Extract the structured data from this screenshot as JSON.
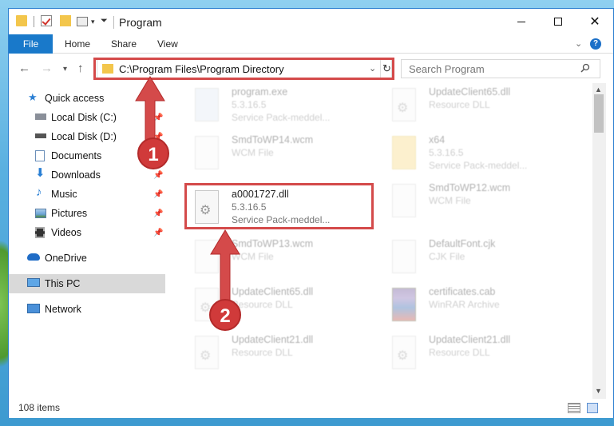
{
  "window": {
    "title": "Program",
    "controls": {
      "minimize": "minimize",
      "maximize": "maximize",
      "close": "✕"
    }
  },
  "ribbon": {
    "tabs": [
      "File",
      "Home",
      "Share",
      "View"
    ],
    "help": "?"
  },
  "nav": {
    "address": "C:\\Program Files\\Program Directory",
    "search_placeholder": "Search Program"
  },
  "sidebar": {
    "items": [
      {
        "label": "Quick access",
        "icon": "star-icon",
        "pinned": false
      },
      {
        "label": "Local Disk (C:)",
        "icon": "drive-icon",
        "pinned": true
      },
      {
        "label": "Local Disk (D:)",
        "icon": "drive-icon",
        "pinned": true
      },
      {
        "label": "Documents",
        "icon": "documents-icon",
        "pinned": true
      },
      {
        "label": "Downloads",
        "icon": "download-icon",
        "pinned": true
      },
      {
        "label": "Music",
        "icon": "music-icon",
        "pinned": true
      },
      {
        "label": "Pictures",
        "icon": "pictures-icon",
        "pinned": true
      },
      {
        "label": "Videos",
        "icon": "videos-icon",
        "pinned": true
      },
      {
        "label": "OneDrive",
        "icon": "cloud-icon",
        "pinned": false
      },
      {
        "label": "This PC",
        "icon": "pc-icon",
        "pinned": false,
        "selected": true
      },
      {
        "label": "Network",
        "icon": "network-icon",
        "pinned": false
      }
    ]
  },
  "files": [
    {
      "name": "program.exe",
      "type": "5.3.16.5",
      "size": "Service Pack-meddel...",
      "icon": "exe"
    },
    {
      "name": "UpdateClient65.dll",
      "type": "Resource DLL",
      "size": "",
      "icon": "dll"
    },
    {
      "name": "SmdToWP14.wcm",
      "type": "WCM File",
      "size": "",
      "icon": "doc"
    },
    {
      "name": "x64",
      "type": "5.3.16.5",
      "size": "Service Pack-meddel...",
      "icon": "folder"
    },
    {
      "name": "a0001727.dll",
      "type": "5.3.16.5",
      "size": "Service Pack-meddel...",
      "icon": "dll",
      "highlighted": true
    },
    {
      "name": "SmdToWP12.wcm",
      "type": "WCM File",
      "size": "",
      "icon": "doc"
    },
    {
      "name": "SmdToWP13.wcm",
      "type": "WCM File",
      "size": "",
      "icon": "doc"
    },
    {
      "name": "DefaultFont.cjk",
      "type": "CJK File",
      "size": "",
      "icon": "doc"
    },
    {
      "name": "UpdateClient65.dll",
      "type": "Resource DLL",
      "size": "",
      "icon": "dll"
    },
    {
      "name": "certificates.cab",
      "type": "WinRAR Archive",
      "size": "",
      "icon": "rar"
    },
    {
      "name": "UpdateClient21.dll",
      "type": "Resource DLL",
      "size": "",
      "icon": "dll"
    },
    {
      "name": "UpdateClient21.dll",
      "type": "Resource DLL",
      "size": "",
      "icon": "dll"
    }
  ],
  "status": {
    "items_count": "108 items"
  },
  "callouts": {
    "step1": "1",
    "step2": "2"
  },
  "colors": {
    "accent": "#1979ca",
    "highlight": "#d44a4a"
  }
}
